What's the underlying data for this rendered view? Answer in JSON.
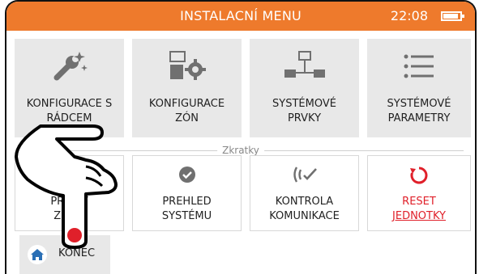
{
  "header": {
    "title": "INSTALACNÍ MENU",
    "time": "22:08",
    "battery_icon": "battery-full-icon",
    "accent_color": "#ee7a2c"
  },
  "main_tiles": [
    {
      "line1": "KONFIGURACE S",
      "line2": "RÁDCEM",
      "icon": "wrench-sparkle-icon"
    },
    {
      "line1": "KONFIGURACE",
      "line2": "ZÓN",
      "icon": "zone-gear-icon"
    },
    {
      "line1": "SYSTÉMOVÉ",
      "line2": "PRVKY",
      "icon": "network-icon"
    },
    {
      "line1": "SYSTÉMOVÉ",
      "line2": "PARAMETRY",
      "icon": "list-icon"
    }
  ],
  "shortcuts": {
    "label": "Zkratky",
    "items": [
      {
        "line1": "PRIDAT",
        "line2": "ZÓNU",
        "icon": "add-zone-icon"
      },
      {
        "line1": "PREHLED",
        "line2": "SYSTÉMU",
        "icon": "check-circle-icon"
      },
      {
        "line1": "KONTROLA",
        "line2": "KOMUNIKACE",
        "icon": "signal-icon"
      },
      {
        "line1": "RESET",
        "line2": "JEDNOTKY",
        "icon": "reset-icon",
        "color": "#e0202a"
      }
    ]
  },
  "footer": {
    "home_label": "KONEC",
    "home_icon": "home-icon",
    "home_icon_color": "#2a6fb5"
  },
  "overlay": {
    "pointer_icon": "pointing-hand-icon",
    "touch_dot_color": "#e0202a"
  }
}
